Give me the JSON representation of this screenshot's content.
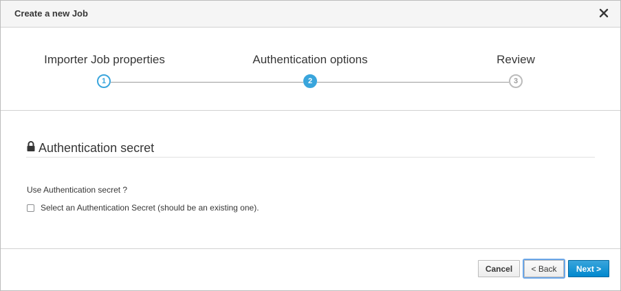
{
  "modal": {
    "title": "Create a new Job",
    "close_icon": "close-icon"
  },
  "wizard": {
    "steps": [
      {
        "label": "Importer Job properties",
        "number": "1",
        "state": "done"
      },
      {
        "label": "Authentication options",
        "number": "2",
        "state": "active"
      },
      {
        "label": "Review",
        "number": "3",
        "state": "todo"
      }
    ]
  },
  "content": {
    "section_icon": "lock-icon",
    "section_title": "Authentication secret",
    "field_label": "Use Authentication secret ?",
    "checkbox_label": "Select an Authentication Secret (should be an existing one).",
    "checkbox_checked": false
  },
  "footer": {
    "cancel_label": "Cancel",
    "back_label": "< Back",
    "next_label": "Next >"
  },
  "colors": {
    "accent": "#39a5dc",
    "primary_button": "#0088ce"
  }
}
